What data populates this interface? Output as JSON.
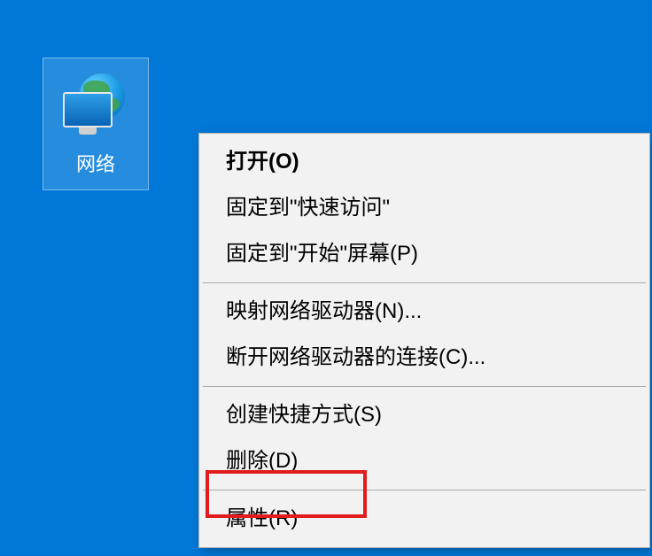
{
  "desktop": {
    "icon_label": "网络"
  },
  "context_menu": {
    "items": [
      {
        "label": "打开(O)",
        "bold": true
      },
      {
        "label": "固定到\"快速访问\""
      },
      {
        "label": "固定到\"开始\"屏幕(P)"
      },
      {
        "divider": true
      },
      {
        "label": "映射网络驱动器(N)..."
      },
      {
        "label": "断开网络驱动器的连接(C)..."
      },
      {
        "divider": true
      },
      {
        "label": "创建快捷方式(S)"
      },
      {
        "label": "删除(D)"
      },
      {
        "divider": true
      },
      {
        "label": "属性(R)"
      }
    ]
  }
}
